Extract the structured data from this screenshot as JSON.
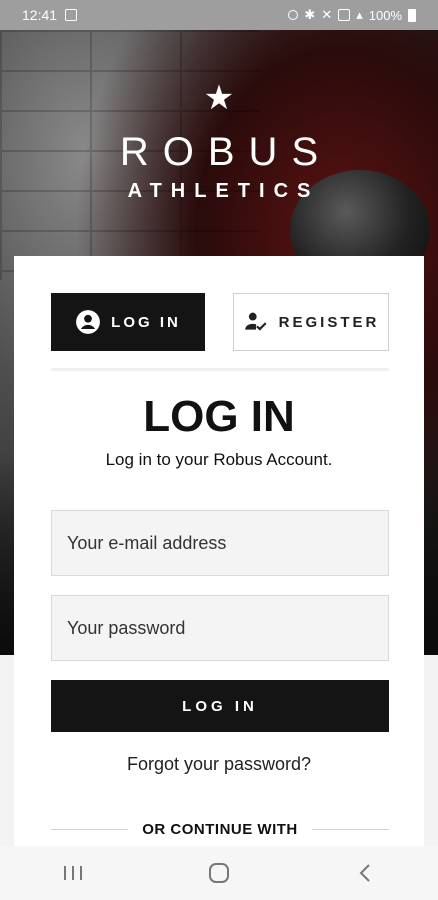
{
  "status_bar": {
    "time": "12:41",
    "battery": "100%"
  },
  "hero": {
    "star": "★",
    "brand": "ROBUS",
    "subbrand": "ATHLETICS"
  },
  "tabs": {
    "login_label": "LOG IN",
    "register_label": "REGISTER"
  },
  "form": {
    "title": "LOG IN",
    "subtitle": "Log in to your Robus Account.",
    "email_placeholder": "Your e-mail address",
    "password_placeholder": "Your password",
    "submit_label": "LOG IN",
    "forgot_link": "Forgot your password?",
    "divider_text": "OR CONTINUE WITH"
  },
  "nav": {
    "recent": "recent-apps-icon",
    "home": "home-icon",
    "back": "back-icon"
  }
}
